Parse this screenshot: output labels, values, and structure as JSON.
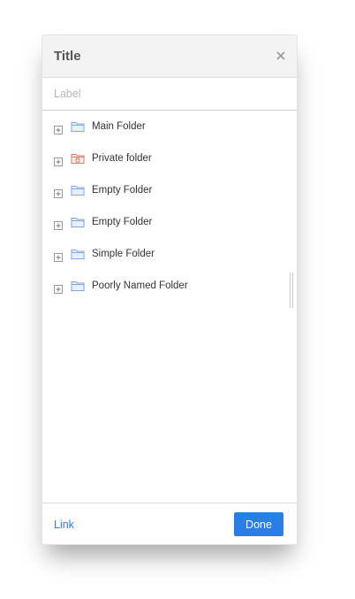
{
  "dialog": {
    "title": "Title",
    "close_icon": "close-icon"
  },
  "label_input": {
    "placeholder": "Label",
    "value": ""
  },
  "tree": {
    "items": [
      {
        "label": "Main Folder",
        "icon": "folder-icon",
        "locked": false
      },
      {
        "label": "Private folder",
        "icon": "locked-folder-icon",
        "locked": true
      },
      {
        "label": "Empty Folder",
        "icon": "folder-icon",
        "locked": false
      },
      {
        "label": "Empty Folder",
        "icon": "folder-icon",
        "locked": false
      },
      {
        "label": "Simple Folder",
        "icon": "folder-icon",
        "locked": false
      },
      {
        "label": "Poorly Named Folder",
        "icon": "folder-icon",
        "locked": false
      }
    ]
  },
  "footer": {
    "link_label": "Link",
    "done_label": "Done"
  },
  "colors": {
    "accent": "#2b7ee8",
    "link": "#2e7bdc",
    "folder": "#7ea9dc",
    "folder_fill": "#e8f1fb",
    "private_folder": "#e07a6a",
    "private_folder_fill": "#fbeeec"
  }
}
